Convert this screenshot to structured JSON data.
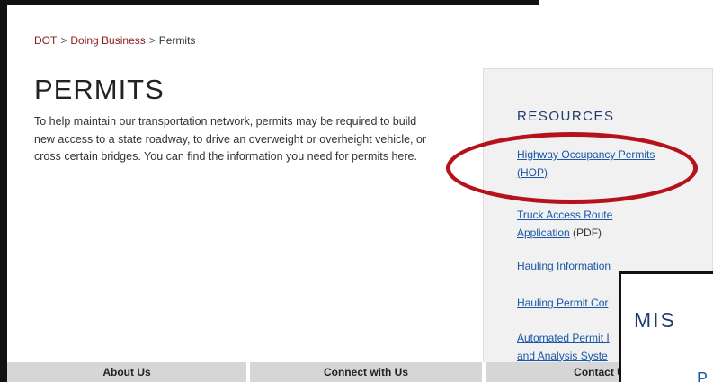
{
  "breadcrumb": {
    "items": [
      "DOT",
      "Doing Business",
      "Permits"
    ],
    "separator": ">"
  },
  "page": {
    "title": "PERMITS",
    "intro_lines": [
      "To help maintain our transportation network, permits may be required to build",
      "new access to a state roadway, to drive an overweight or overheight vehicle, or",
      "cross certain bridges. You can find the information you need for permits here."
    ]
  },
  "resources": {
    "title": "RESOURCES",
    "links": [
      {
        "lines": [
          "Highway Occupancy Permits",
          "(HOP)"
        ],
        "suffix": ""
      },
      {
        "lines": [
          "Truck Access Route",
          "Application"
        ],
        "suffix": " (PDF)"
      },
      {
        "lines": [
          "Hauling Information"
        ],
        "suffix": ""
      },
      {
        "lines": [
          "Hauling Permit Cor"
        ],
        "suffix": ""
      },
      {
        "lines": [
          "Automated Permit I",
          "and Analysis Syste"
        ],
        "suffix": ""
      }
    ]
  },
  "footer": {
    "items": [
      "About Us",
      "Connect with Us",
      "Contact U"
    ]
  },
  "popup": {
    "title": "MIS",
    "subtitle": "P"
  },
  "colors": {
    "link": "#1a57a6",
    "breadcrumb_link": "#8b1a1a",
    "highlight_circle": "#b5121b",
    "heading": "#1e3d6b"
  }
}
